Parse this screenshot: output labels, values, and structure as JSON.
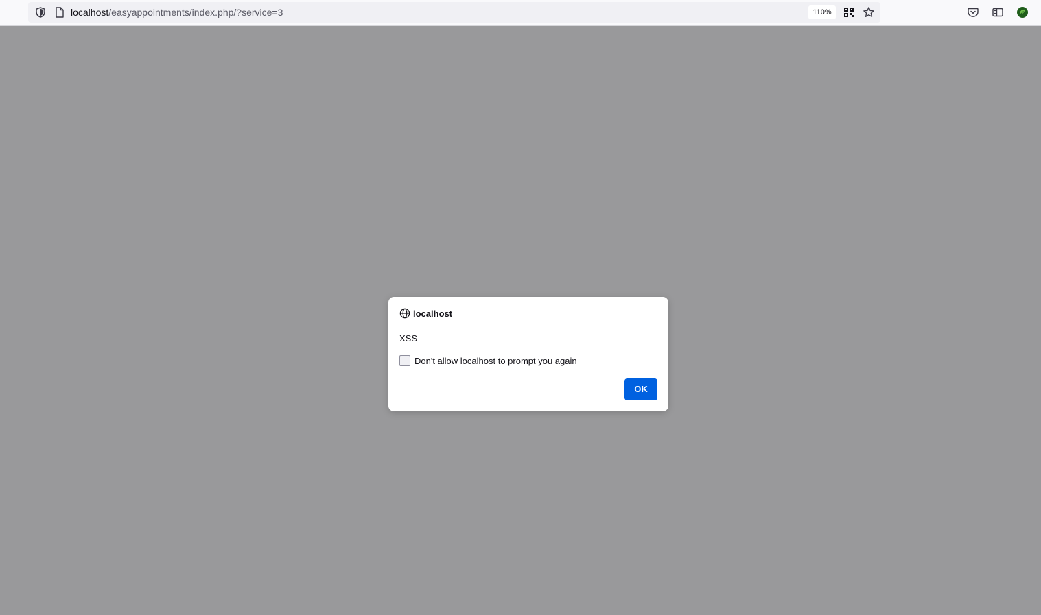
{
  "browser": {
    "url_host": "localhost",
    "url_path": "/easyappointments/index.php/?service=3",
    "zoom": "110%",
    "icons": {
      "shield": "tracking-protection-shield-icon",
      "page": "page-document-icon",
      "qr": "qr-code-icon",
      "star": "bookmark-star-icon",
      "pocket": "pocket-icon",
      "sidebar": "sidebar-icon",
      "account": "account-avatar-icon"
    }
  },
  "dialog": {
    "origin": "localhost",
    "message": "XSS",
    "checkbox_label": "Don't allow localhost to prompt you again",
    "checkbox_checked": false,
    "ok_label": "OK",
    "colors": {
      "ok_background": "#0061e0",
      "overlay": "#99999b"
    }
  }
}
